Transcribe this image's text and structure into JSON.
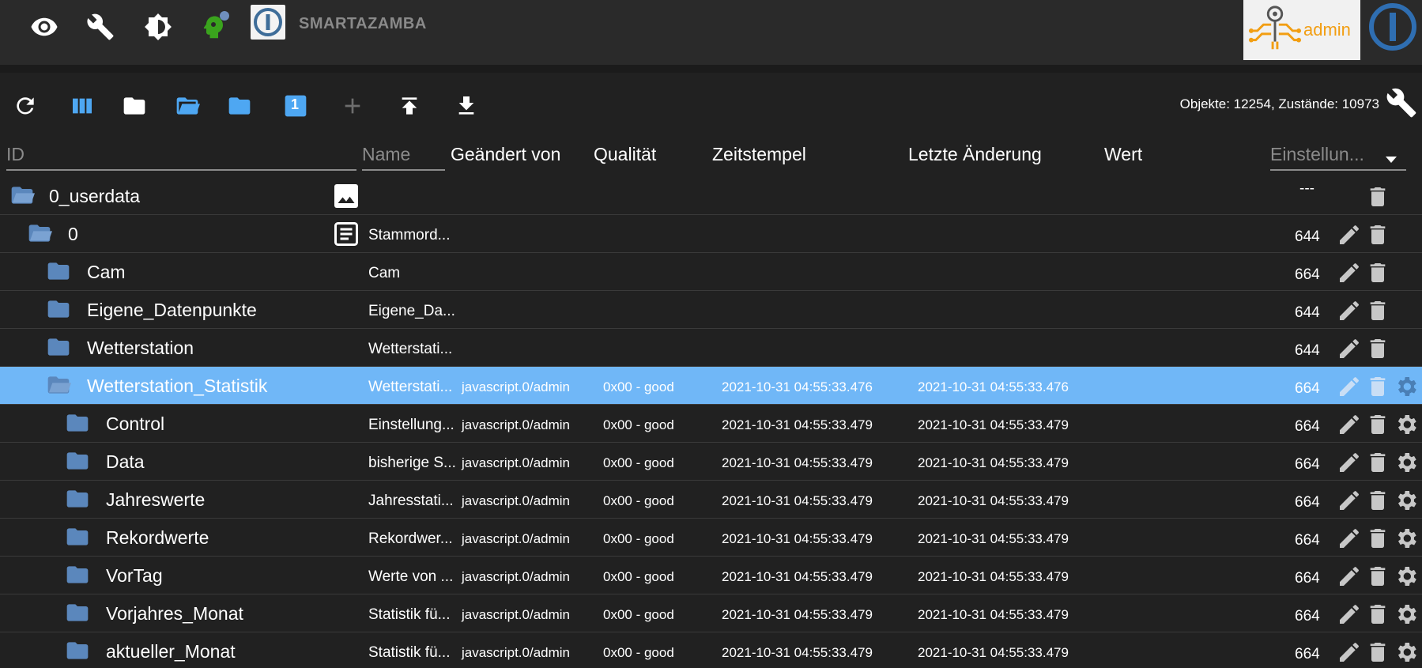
{
  "appbar": {
    "title": "SMARTAZAMBA",
    "admin_label": "admin",
    "icons": [
      "eye-icon",
      "wrench-icon",
      "theme-icon",
      "expert-mode-icon"
    ]
  },
  "toolbar": {
    "buttons": [
      "refresh-icon",
      "columns-icon",
      "folder-icon",
      "folder-open-icon",
      "folder-blue-icon",
      "level-1-icon",
      "add-icon",
      "upload-icon",
      "download-icon"
    ],
    "level_label": "1",
    "stats": "Objekte: 12254, Zustände: 10973"
  },
  "columns": {
    "id_placeholder": "ID",
    "name_placeholder": "Name",
    "changed_by": "Geändert von",
    "quality": "Qualität",
    "timestamp": "Zeitstempel",
    "last_change": "Letzte Änderung",
    "value": "Wert",
    "settings": "Einstellun..."
  },
  "rows": [
    {
      "id": "0_userdata",
      "name": "",
      "changed_by": "",
      "quality": "",
      "ts": "",
      "lc": "",
      "acl": "---",
      "edit": false,
      "cfg": false
    },
    {
      "id": "0",
      "name": "Stammord...",
      "changed_by": "",
      "quality": "",
      "ts": "",
      "lc": "",
      "acl": "644",
      "edit": true,
      "cfg": false
    },
    {
      "id": "Cam",
      "name": "Cam",
      "changed_by": "",
      "quality": "",
      "ts": "",
      "lc": "",
      "acl": "664",
      "edit": true,
      "cfg": false
    },
    {
      "id": "Eigene_Datenpunkte",
      "name": "Eigene_Da...",
      "changed_by": "",
      "quality": "",
      "ts": "",
      "lc": "",
      "acl": "644",
      "edit": true,
      "cfg": false
    },
    {
      "id": "Wetterstation",
      "name": "Wetterstati...",
      "changed_by": "",
      "quality": "",
      "ts": "",
      "lc": "",
      "acl": "644",
      "edit": true,
      "cfg": false
    },
    {
      "id": "Wetterstation_Statistik",
      "name": "Wetterstati...",
      "changed_by": "javascript.0/admin",
      "quality": "0x00 - good",
      "ts": "2021-10-31 04:55:33.476",
      "lc": "2021-10-31 04:55:33.476",
      "acl": "664",
      "edit": true,
      "cfg": true
    },
    {
      "id": "Control",
      "name": "Einstellung...",
      "changed_by": "javascript.0/admin",
      "quality": "0x00 - good",
      "ts": "2021-10-31 04:55:33.479",
      "lc": "2021-10-31 04:55:33.479",
      "acl": "664",
      "edit": true,
      "cfg": true
    },
    {
      "id": "Data",
      "name": "bisherige S...",
      "changed_by": "javascript.0/admin",
      "quality": "0x00 - good",
      "ts": "2021-10-31 04:55:33.479",
      "lc": "2021-10-31 04:55:33.479",
      "acl": "664",
      "edit": true,
      "cfg": true
    },
    {
      "id": "Jahreswerte",
      "name": "Jahresstati...",
      "changed_by": "javascript.0/admin",
      "quality": "0x00 - good",
      "ts": "2021-10-31 04:55:33.479",
      "lc": "2021-10-31 04:55:33.479",
      "acl": "664",
      "edit": true,
      "cfg": true
    },
    {
      "id": "Rekordwerte",
      "name": "Rekordwer...",
      "changed_by": "javascript.0/admin",
      "quality": "0x00 - good",
      "ts": "2021-10-31 04:55:33.479",
      "lc": "2021-10-31 04:55:33.479",
      "acl": "664",
      "edit": true,
      "cfg": true
    },
    {
      "id": "VorTag",
      "name": "Werte von ...",
      "changed_by": "javascript.0/admin",
      "quality": "0x00 - good",
      "ts": "2021-10-31 04:55:33.479",
      "lc": "2021-10-31 04:55:33.479",
      "acl": "664",
      "edit": true,
      "cfg": true
    },
    {
      "id": "Vorjahres_Monat",
      "name": "Statistik fü...",
      "changed_by": "javascript.0/admin",
      "quality": "0x00 - good",
      "ts": "2021-10-31 04:55:33.479",
      "lc": "2021-10-31 04:55:33.479",
      "acl": "664",
      "edit": true,
      "cfg": true
    },
    {
      "id": "aktueller_Monat",
      "name": "Statistik fü...",
      "changed_by": "javascript.0/admin",
      "quality": "0x00 - good",
      "ts": "2021-10-31 04:55:33.479",
      "lc": "2021-10-31 04:55:33.479",
      "acl": "664",
      "edit": true,
      "cfg": true
    }
  ],
  "colors": {
    "background": "#212121",
    "appbar": "#2a2a2a",
    "selected_row": "#70b7f7",
    "folder": "#5b87bc",
    "folder_light": "#c9def5",
    "toolbar_accent": "#4ea7f2",
    "admin_orange": "#f29e12",
    "expert_green": "#3aa31d"
  }
}
